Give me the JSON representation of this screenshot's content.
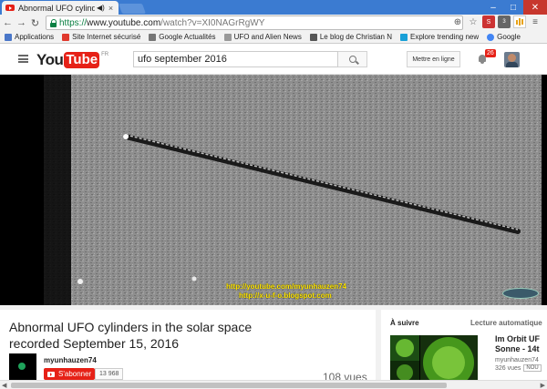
{
  "browser": {
    "tab_title": "Abnormal UFO cylinde",
    "tab_audio_icon": "speaker-icon",
    "tab_close": "×",
    "url_scheme": "https://",
    "url_host": "www.youtube.com",
    "url_path": "/watch?v=XI0NAGrRgWY",
    "ext_badge": "3"
  },
  "bookmarks": [
    {
      "label": "Applications",
      "color": "#4a77c9"
    },
    {
      "label": "Site Internet sécurisé",
      "color": "#e0392d"
    },
    {
      "label": "Google Actualités",
      "color": "#777777"
    },
    {
      "label": "UFO and Alien News",
      "color": "#999999"
    },
    {
      "label": "Le blog de Christian N",
      "color": "#555555"
    },
    {
      "label": "Explore trending new",
      "color": "#19a0d8"
    },
    {
      "label": "Google",
      "color": "#4285f4"
    }
  ],
  "youtube": {
    "logo_you": "You",
    "logo_tube": "Tube",
    "logo_region": "FR",
    "search_query": "ufo september 2016",
    "upload_label": "Mettre en ligne",
    "notification_count": "26"
  },
  "video": {
    "watermark_line1": "http://youtube.com/myunhauzen74",
    "watermark_line2": "http://x-u-f-o.blogspot.com",
    "title": "Abnormal UFO cylinders in the solar space recorded September 15, 2016",
    "channel": "myunhauzen74",
    "subscribe_label": "S'abonner",
    "subscriber_count": "13 968",
    "views": "108 vues"
  },
  "sidebar": {
    "up_next_label": "À suivre",
    "autoplay_label": "Lecture automatique",
    "next_title_line1": "Im Orbit UF",
    "next_title_line2": "Sonne - 14t",
    "next_channel": "myunhauzen74",
    "next_views": "326 vues",
    "next_badge": "NOU"
  },
  "colors": {
    "youtube_red": "#e62117",
    "url_green": "#0b8043",
    "tab_strip": "#3b7bd1"
  }
}
